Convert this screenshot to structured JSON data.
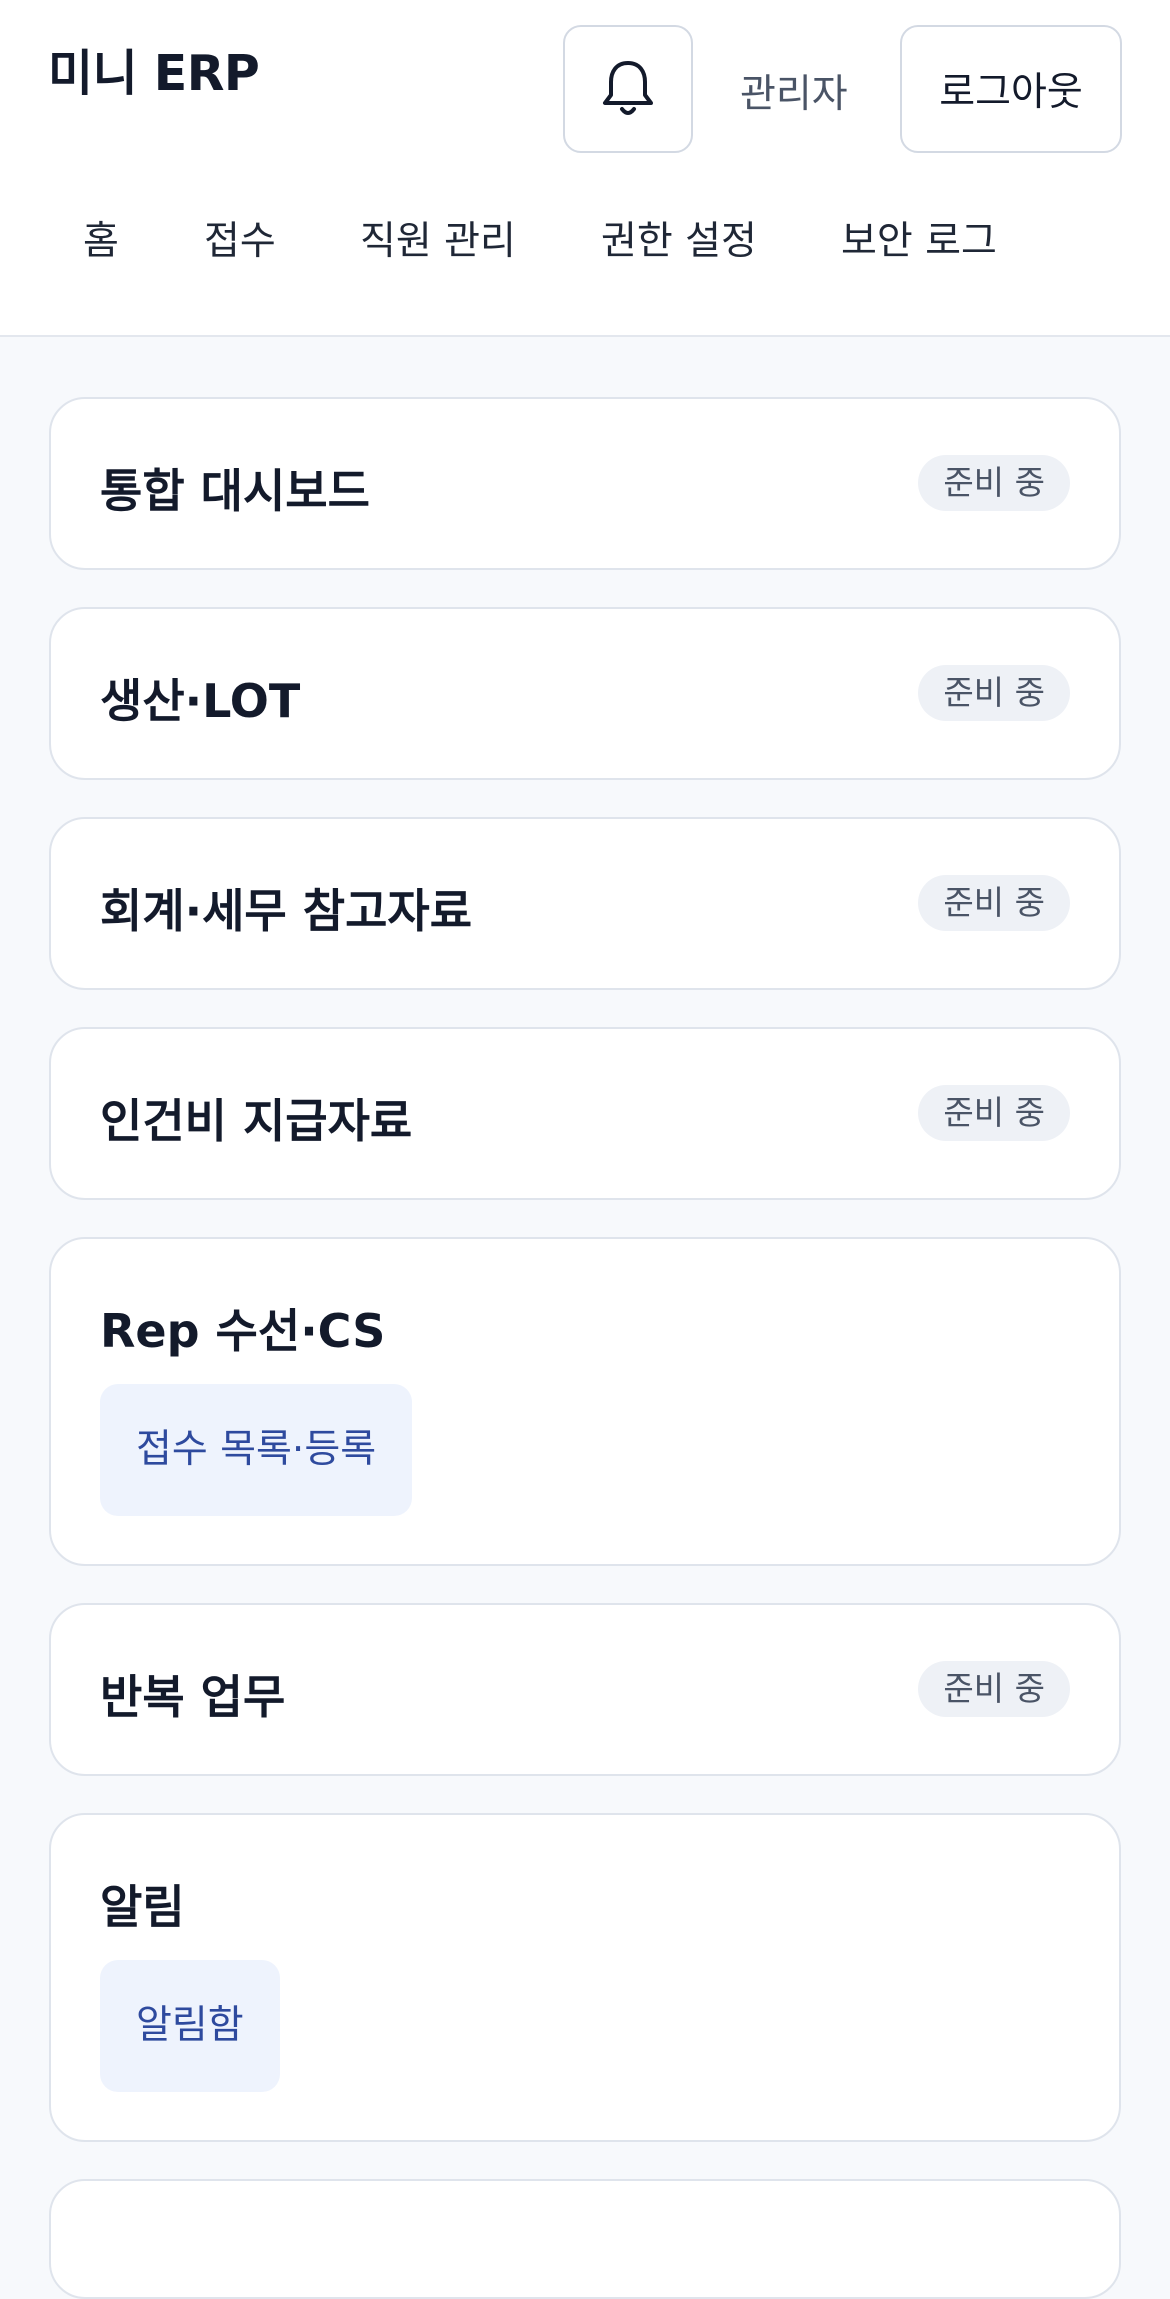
{
  "header": {
    "app_title": "미니 ERP",
    "user_name": "관리자",
    "logout_label": "로그아웃"
  },
  "nav": {
    "items": [
      {
        "label": "홈"
      },
      {
        "label": "접수"
      },
      {
        "label": "직원 관리"
      },
      {
        "label": "권한 설정"
      },
      {
        "label": "보안 로그"
      }
    ]
  },
  "modules": [
    {
      "title": "통합 대시보드",
      "badge": "준비 중"
    },
    {
      "title": "생산·LOT",
      "badge": "준비 중"
    },
    {
      "title": "회계·세무 참고자료",
      "badge": "준비 중"
    },
    {
      "title": "인건비 지급자료",
      "badge": "준비 중"
    },
    {
      "title": "Rep 수선·CS",
      "link": "접수 목록·등록"
    },
    {
      "title": "반복 업무",
      "badge": "준비 중"
    },
    {
      "title": "알림",
      "link": "알림함"
    }
  ],
  "colors": {
    "background": "#f7f9fc",
    "card": "#ffffff",
    "link_bg": "#eef3fd",
    "link_text": "#2e4a9e",
    "badge_bg": "#eef1f6"
  },
  "icons": {
    "notifications": "bell-icon"
  }
}
